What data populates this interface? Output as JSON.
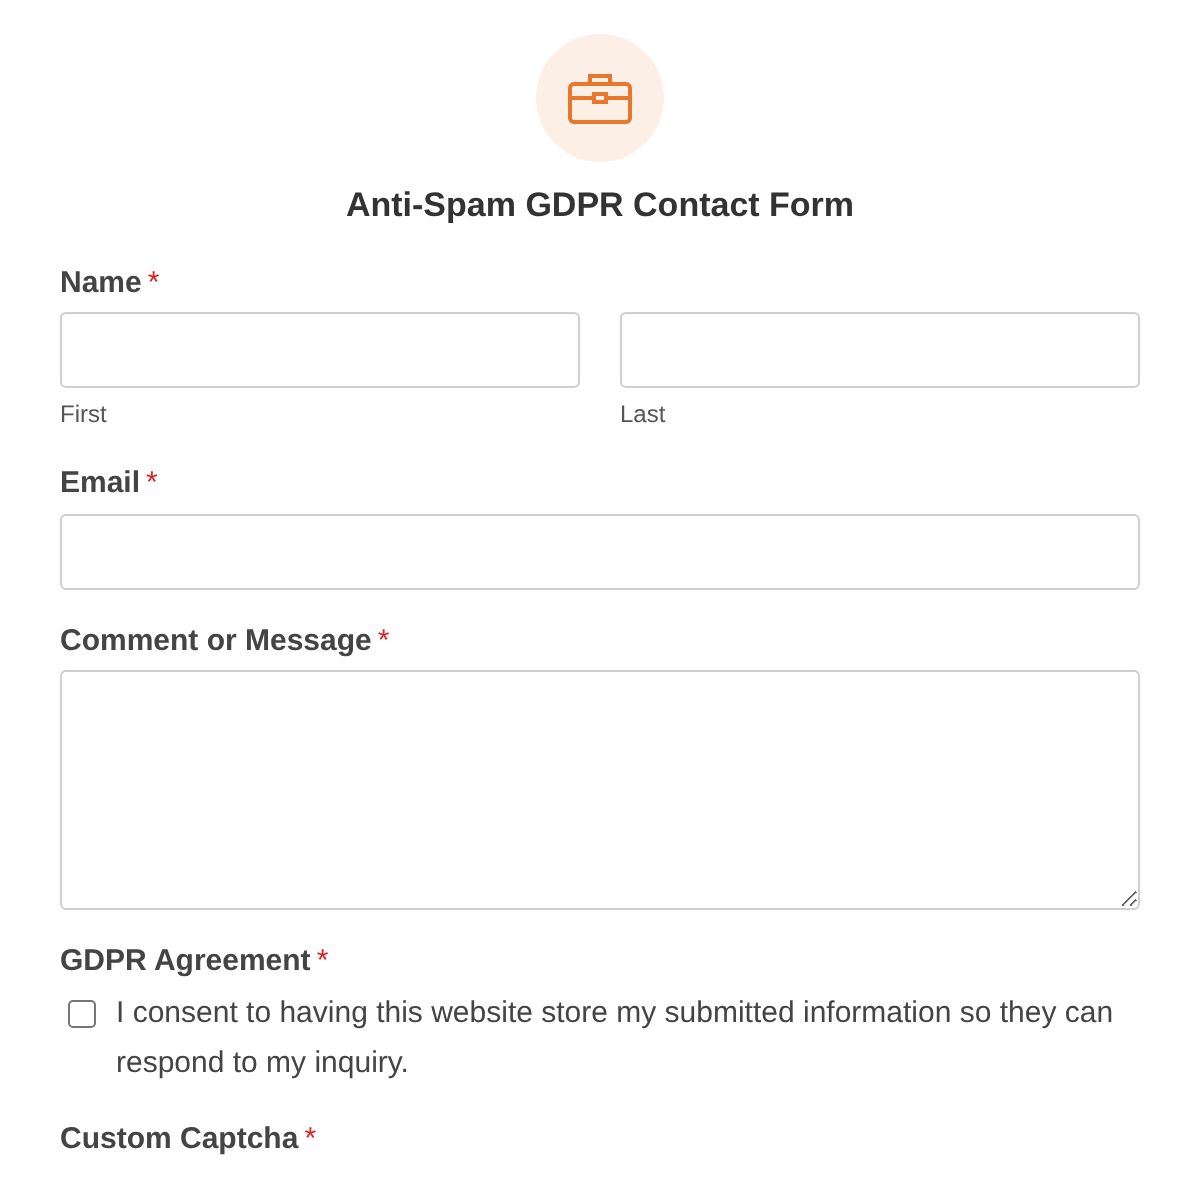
{
  "form": {
    "title": "Anti-Spam GDPR Contact Form"
  },
  "fields": [
    {
      "kind": "name",
      "label": "Name",
      "required_mark": "*",
      "sublabels": [
        "First",
        "Last"
      ]
    },
    {
      "kind": "text",
      "label": "Email",
      "required_mark": "*"
    },
    {
      "kind": "textarea",
      "label": "Comment or Message",
      "required_mark": "*"
    },
    {
      "kind": "checkbox",
      "label": "GDPR Agreement",
      "required_mark": "*",
      "option": "I consent to having this website store my submitted information so they can respond to my inquiry.",
      "checked": false
    },
    {
      "kind": "label_only",
      "label": "Custom Captcha",
      "required_mark": "*"
    }
  ]
}
